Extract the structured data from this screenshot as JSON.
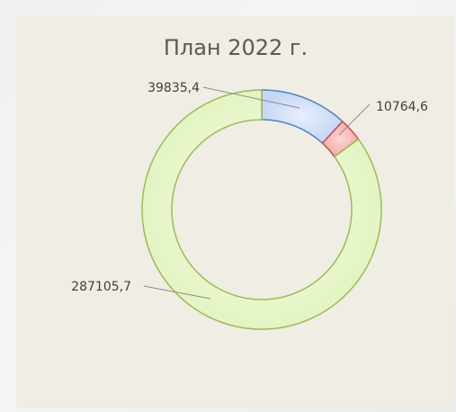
{
  "chart_data": {
    "type": "pie",
    "subtype": "doughnut",
    "title": "План 2022 г.",
    "values": [
      39835.4,
      10764.6,
      287105.7
    ],
    "data_labels": [
      "39835,4",
      "10764,6",
      "287105,7"
    ],
    "colors": {
      "fills": [
        "#c9d9f7",
        "#f7b9b6",
        "#eef8d6"
      ],
      "strokes": [
        "#4f81bd",
        "#c0504d",
        "#9bbb59"
      ]
    }
  }
}
